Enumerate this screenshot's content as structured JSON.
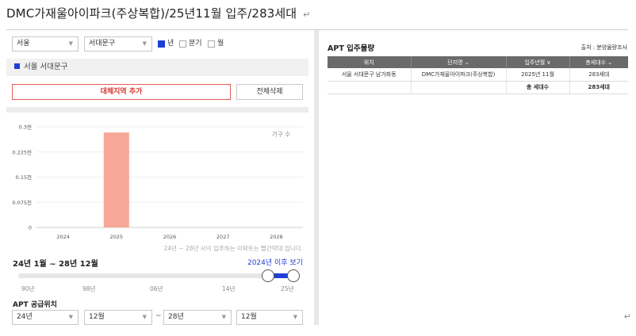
{
  "document": {
    "title": "DMC가재울아이파크(주상복합)/25년11월 입주/283세대",
    "paragraph_mark": "↵"
  },
  "filters": {
    "city": "서울",
    "district": "서대문구",
    "period_options": [
      {
        "label": "년",
        "checked": true
      },
      {
        "label": "분기",
        "checked": false
      },
      {
        "label": "월",
        "checked": false
      }
    ]
  },
  "region_label": "서울 서대문구",
  "buttons": {
    "add_region": "대체지역 추가",
    "clear_all": "전체삭제"
  },
  "chart_data": {
    "type": "bar",
    "categories": [
      "2024",
      "2025",
      "2026",
      "2027",
      "2028"
    ],
    "series": [
      {
        "values": [
          0,
          283,
          0,
          0,
          0
        ]
      }
    ],
    "ylim": [
      0,
      300
    ],
    "y_ticks": [
      "0",
      "0.075천",
      "0.15천",
      "0.225천",
      "0.3천"
    ],
    "ylabel": "가구 수",
    "bar_color": "#f7a797",
    "grid": true,
    "note": "24년 ~ 28년 사이 입주하는 아파트는 빨간막대 입니다."
  },
  "range": {
    "title": "24년 1월 ~ 28년 12월",
    "link": "2024년 이후 보기",
    "slider_labels": [
      "90년",
      "98년",
      "06년",
      "14년",
      "25년"
    ],
    "accent_color": "#1f3fd6"
  },
  "supply": {
    "title": "APT 공급위치",
    "from_year": "24년",
    "from_month": "12월",
    "tilde": "~",
    "to_year": "28년",
    "to_month": "12월"
  },
  "apt_table": {
    "title": "APT 입주물량",
    "source": "출처 : 분양물량조사",
    "headers": [
      "위치",
      "단지명 ⌄",
      "입주년월 ∨",
      "총세대수 ⌄"
    ],
    "rows": [
      [
        "서울 서대문구 남가좌동",
        "DMC가재울아이파크(주상복합)",
        "2025년 11월",
        "283세대"
      ],
      [
        "",
        "",
        "총 세대수",
        "283세대"
      ]
    ]
  }
}
